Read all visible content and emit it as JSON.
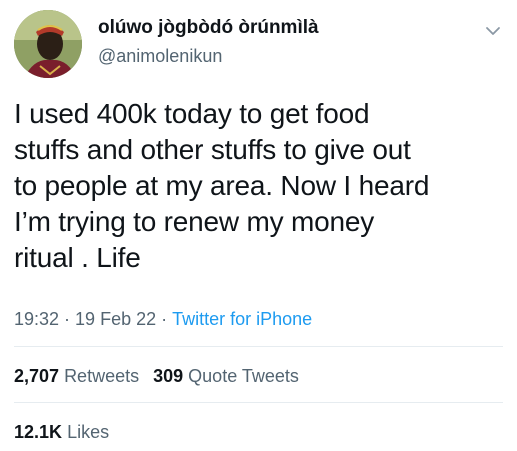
{
  "user": {
    "display_name": "olúwo jògbòdó òrúnmìlà",
    "handle": "@animolenikun"
  },
  "menu_icon": "chevron-down-icon",
  "tweet": {
    "lines": [
      "I used 400k today to get food",
      "stuffs and other stuffs to give out",
      "to people at my area. Now I heard",
      "I’m trying to renew my money",
      "ritual . Life"
    ]
  },
  "meta": {
    "time": "19:32",
    "separator": "·",
    "date": "19 Feb 22",
    "source": "Twitter for iPhone"
  },
  "stats": {
    "retweets_count": "2,707",
    "retweets_label": "Retweets",
    "quote_count": "309",
    "quote_label": "Quote Tweets",
    "likes_count": "12.1K",
    "likes_label": "Likes"
  },
  "colors": {
    "text_primary": "#0f1419",
    "text_secondary": "#536471",
    "link": "#1d9bf0",
    "divider": "#e6ecf0"
  }
}
